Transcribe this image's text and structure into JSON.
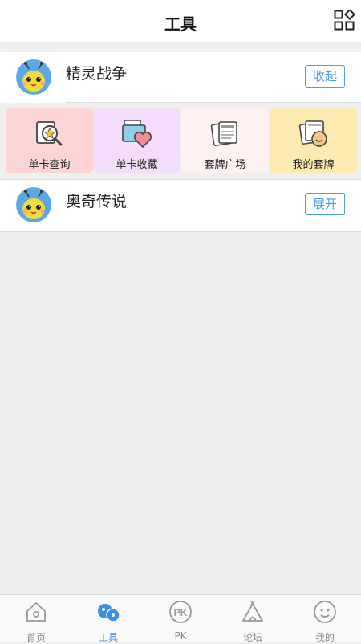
{
  "header": {
    "title": "工具",
    "menu_icon": "grid-icon"
  },
  "games": [
    {
      "name": "精灵战争",
      "toggle_label": "收起",
      "expanded": true,
      "avatar_icon": "bee-avatar"
    },
    {
      "name": "奥奇传说",
      "toggle_label": "展开",
      "expanded": false,
      "avatar_icon": "bee-avatar"
    }
  ],
  "tools": [
    {
      "label": "单卡查询",
      "icon": "card-search-icon",
      "color": "#fcd4d4"
    },
    {
      "label": "单卡收藏",
      "icon": "card-favorite-icon",
      "color": "#f3ddfb"
    },
    {
      "label": "套牌广场",
      "icon": "deck-square-icon",
      "color": "#fdf1f2"
    },
    {
      "label": "我的套牌",
      "icon": "my-deck-icon",
      "color": "#fdeab0"
    }
  ],
  "tabbar": {
    "active_color": "#3b8fe0",
    "inactive_color": "#8a8a8a",
    "items": [
      {
        "label": "首页",
        "icon": "home-icon",
        "active": false
      },
      {
        "label": "工具",
        "icon": "tools-icon",
        "active": true
      },
      {
        "label": "PK",
        "icon": "pk-icon",
        "active": false
      },
      {
        "label": "论坛",
        "icon": "forum-icon",
        "active": false
      },
      {
        "label": "我的",
        "icon": "profile-icon",
        "active": false
      }
    ]
  }
}
